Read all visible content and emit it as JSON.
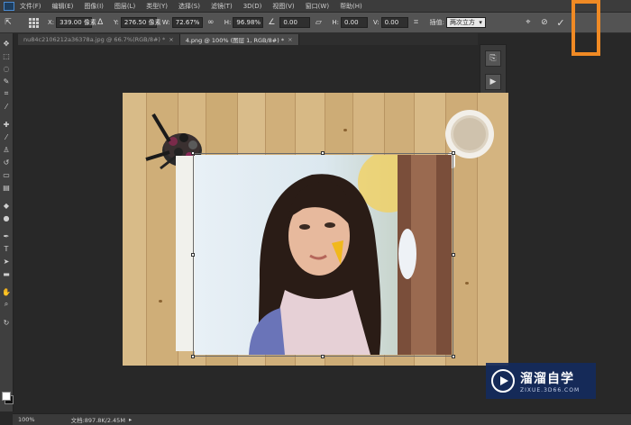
{
  "menu": {
    "items": [
      "文件(F)",
      "编辑(E)",
      "图像(I)",
      "图层(L)",
      "类型(Y)",
      "选择(S)",
      "滤镜(T)",
      "3D(D)",
      "视图(V)",
      "窗口(W)",
      "帮助(H)"
    ]
  },
  "options": {
    "x_label": "X:",
    "x_value": "339.00 像素",
    "y_label": "Y:",
    "y_value": "276.50 像素",
    "w_label": "W:",
    "w_value": "72.67%",
    "h_label": "H:",
    "h_value": "96.98%",
    "angle_value": "0.00",
    "hskew_label": "H:",
    "hskew_value": "0.00",
    "vskew_label": "V:",
    "vskew_value": "0.00",
    "interp_label": "插值:",
    "interp_value": "两次立方"
  },
  "tabs": [
    {
      "label": "nu84c2106212a36378a.jpg @ 66.7%(RGB/8#) *",
      "active": false
    },
    {
      "label": "4.png @ 100% (图层 1, RGB/8#) *",
      "active": true
    }
  ],
  "status": {
    "zoom": "100%",
    "doc": "文档:897.8K/2.45M"
  },
  "watermark": {
    "title": "溜溜自学",
    "url": "ZIXUE.3D66.COM"
  },
  "colors": {
    "highlight": "#f08a24",
    "foreground": "#ffffff",
    "background": "#111111"
  }
}
